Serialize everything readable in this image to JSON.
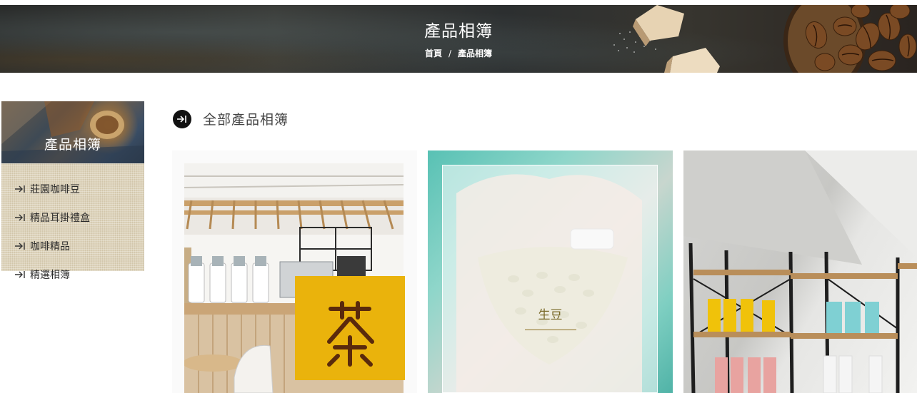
{
  "banner": {
    "title": "產品相簿",
    "breadcrumb": {
      "home": "首頁",
      "separator": "/",
      "current": "產品相簿"
    }
  },
  "sidebar": {
    "title": "產品相簿",
    "items": [
      {
        "label": "莊園咖啡豆"
      },
      {
        "label": "精品耳掛禮盒"
      },
      {
        "label": "咖啡精品"
      },
      {
        "label": "精選相簿"
      }
    ]
  },
  "main": {
    "section_title": "全部產品相簿",
    "cards": [
      {
        "label": ""
      },
      {
        "label": "生豆"
      },
      {
        "label": ""
      }
    ]
  },
  "logo_text": "茶",
  "colors": {
    "accent_gold": "#eab30c",
    "sidebar_bg": "#ddd3bb",
    "label_gold": "#7a6a2a"
  },
  "icons": {
    "arrow": "arrow-right-bar-icon",
    "section": "circle-arrow-icon"
  }
}
